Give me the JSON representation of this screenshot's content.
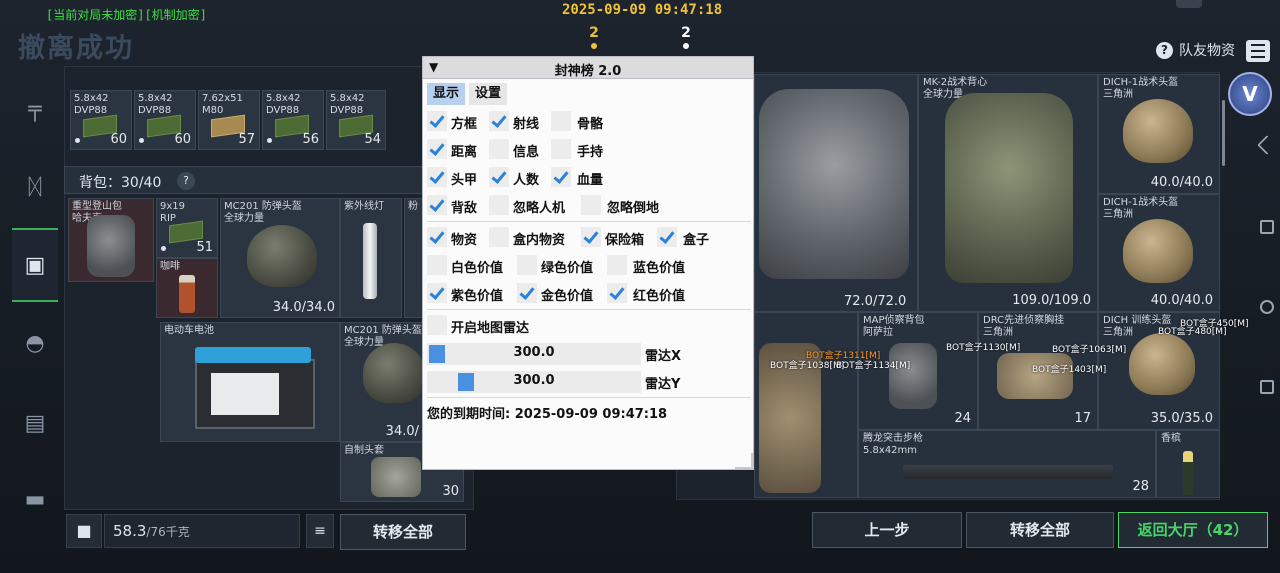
{
  "top": {
    "encryption_status": "[当前对局未加密][机制加密]",
    "title": "撤离成功",
    "clock": "2025-09-09 09:47:18",
    "counter_left": "2",
    "counter_right": "2",
    "teammate_items": "队友物资"
  },
  "sidebar": {
    "items": [
      "weapon-icon",
      "armor-icon",
      "safe-box-icon",
      "backpack-icon",
      "vest-icon",
      "case-icon"
    ],
    "active_index": 2
  },
  "left_panel": {
    "ammo": [
      {
        "name": "5.8x42\nDVP88",
        "count": "60"
      },
      {
        "name": "5.8x42\nDVP88",
        "count": "60"
      },
      {
        "name": "7.62x51\nM80",
        "count": "57"
      },
      {
        "name": "5.8x42\nDVP88",
        "count": "56"
      },
      {
        "name": "5.8x42\nDVP88",
        "count": "54"
      }
    ],
    "bag_label": "背包：30/40",
    "bag_help": "?",
    "items": [
      {
        "name": "重型登山包\n哈夫克",
        "value": ""
      },
      {
        "name": "9x19\nRIP",
        "value": "51"
      },
      {
        "name": "咖啡",
        "value": ""
      },
      {
        "name": "MC201 防弹头盔\n全球力量",
        "value": "34.0/34.0"
      },
      {
        "name": "紫外线灯",
        "value": ""
      },
      {
        "name": "粉",
        "value": ""
      },
      {
        "name": "电动车电池",
        "value": ""
      },
      {
        "name": "MC201 防弹头盔\n全球力量",
        "value": "34.0/"
      },
      {
        "name": "自制头套",
        "value": "30"
      }
    ]
  },
  "bottom": {
    "weight_value": "58.3",
    "weight_capacity": "/76千克",
    "transfer_all_left": "转移全部",
    "back": "上一步",
    "transfer_all_right": "转移全部",
    "return_lobby": "返回大厅（42）"
  },
  "right_panel": {
    "items": [
      {
        "name": "",
        "value": ""
      },
      {
        "name": "MK-2战术背心\n全球力量",
        "value": "72.0/72.0"
      },
      {
        "name": "",
        "value": "109.0/109.0"
      },
      {
        "name": "DICH-1战术头盔\n三角洲",
        "value": "40.0/40.0"
      },
      {
        "name": "DICH-1战术头盔\n三角洲",
        "value": "40.0/40.0"
      },
      {
        "name": "MAP侦察背包\n阿萨拉",
        "value": "24"
      },
      {
        "name": "DRC先进侦察胸挂\n三角洲",
        "value": "17"
      },
      {
        "name": "DICH 训练头盔\n三角洲",
        "value": "35.0/35.0"
      },
      {
        "name": "腾龙突击步枪\n5.8x42mm",
        "value": "28"
      },
      {
        "name": "香槟",
        "value": ""
      }
    ],
    "esp_labels": [
      "BOT盒子1311[M]",
      "BOT盒子1038[M]",
      "BOT盒子1134[M]",
      "BOT盒子1130[M]",
      "BOT盒子1063[M]",
      "BOT盒子1403[M]",
      "BOT盒子450[M]",
      "BOT盒子480[M]"
    ],
    "avatar_letter": "V"
  },
  "cheat_menu": {
    "title": "封神榜 2.0",
    "collapse_glyph": "▼",
    "tabs": [
      "显示",
      "设置"
    ],
    "options": [
      {
        "label": "方框",
        "checked": true
      },
      {
        "label": "射线",
        "checked": true
      },
      {
        "label": "骨骼",
        "checked": false
      },
      {
        "label": "距离",
        "checked": true
      },
      {
        "label": "信息",
        "checked": false
      },
      {
        "label": "手持",
        "checked": false
      },
      {
        "label": "头甲",
        "checked": true
      },
      {
        "label": "人数",
        "checked": true
      },
      {
        "label": "血量",
        "checked": true
      },
      {
        "label": "背敌",
        "checked": true
      },
      {
        "label": "忽略人机",
        "checked": false
      },
      {
        "label": "忽略倒地",
        "checked": false
      },
      {
        "label": "物资",
        "checked": true
      },
      {
        "label": "盒内物资",
        "checked": false
      },
      {
        "label": "保险箱",
        "checked": true
      },
      {
        "label": "盒子",
        "checked": true
      },
      {
        "label": "白色价值",
        "checked": false
      },
      {
        "label": "绿色价值",
        "checked": false
      },
      {
        "label": "蓝色价值",
        "checked": false
      },
      {
        "label": "紫色价值",
        "checked": true
      },
      {
        "label": "金色价值",
        "checked": true
      },
      {
        "label": "红色价值",
        "checked": true
      },
      {
        "label": "开启地图雷达",
        "checked": false
      }
    ],
    "radar_x": {
      "value": "300.0",
      "label": "雷达X",
      "level": 0.0
    },
    "radar_y": {
      "value": "300.0",
      "label": "雷达Y",
      "level": 0.15
    },
    "expiry": "您的到期时间: 2025-09-09 09:47:18"
  }
}
